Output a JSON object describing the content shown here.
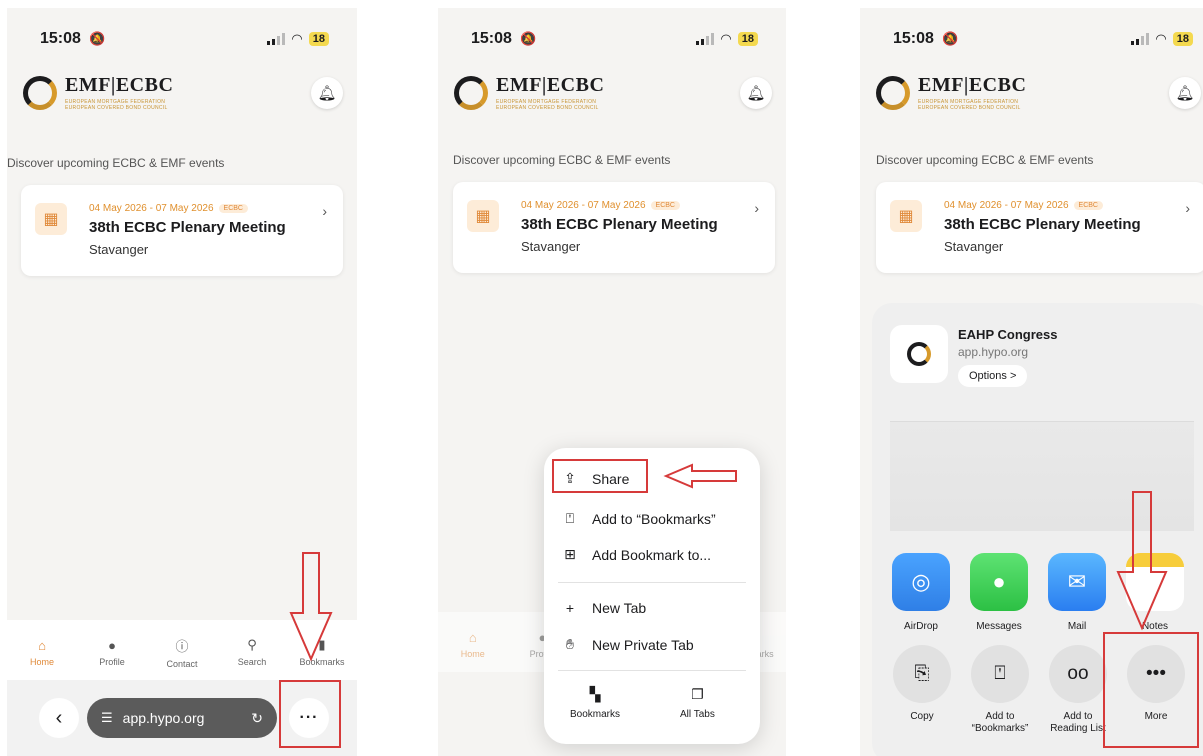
{
  "status": {
    "time": "15:08",
    "battery": "18"
  },
  "logo": {
    "name": "EMF|ECBC",
    "line1": "EUROPEAN MORTGAGE FEDERATION",
    "line2": "EUROPEAN COVERED BOND COUNCIL"
  },
  "discover_text": "Discover upcoming ECBC & EMF events",
  "event": {
    "date": "04 May 2026 - 07 May 2026",
    "badge": "ECBC",
    "title": "38th ECBC Plenary Meeting",
    "location": "Stavanger"
  },
  "tabs": [
    {
      "label": "Home",
      "icon": "home-icon"
    },
    {
      "label": "Profile",
      "icon": "person-icon"
    },
    {
      "label": "Contact",
      "icon": "info-icon"
    },
    {
      "label": "Search",
      "icon": "search-icon"
    },
    {
      "label": "Bookmarks",
      "icon": "bookmark-icon"
    }
  ],
  "urlbar": {
    "url": "app.hypo.org"
  },
  "menu": {
    "share": "Share",
    "add_to_bookmarks": "Add to “Bookmarks”",
    "add_bookmark_to": "Add Bookmark to...",
    "new_tab": "New Tab",
    "new_private_tab": "New Private Tab",
    "bookmarks": "Bookmarks",
    "all_tabs": "All Tabs"
  },
  "sheet": {
    "title": "EAHP Congress",
    "url": "app.hypo.org",
    "options": "Options >",
    "apps": [
      "AirDrop",
      "Messages",
      "Mail",
      "Notes"
    ],
    "actions": [
      "Copy",
      "Add to “Bookmarks”",
      "Add to Reading List",
      "More"
    ]
  },
  "colors": {
    "accent": "#e08a3a",
    "annotation": "#d63a3a"
  }
}
